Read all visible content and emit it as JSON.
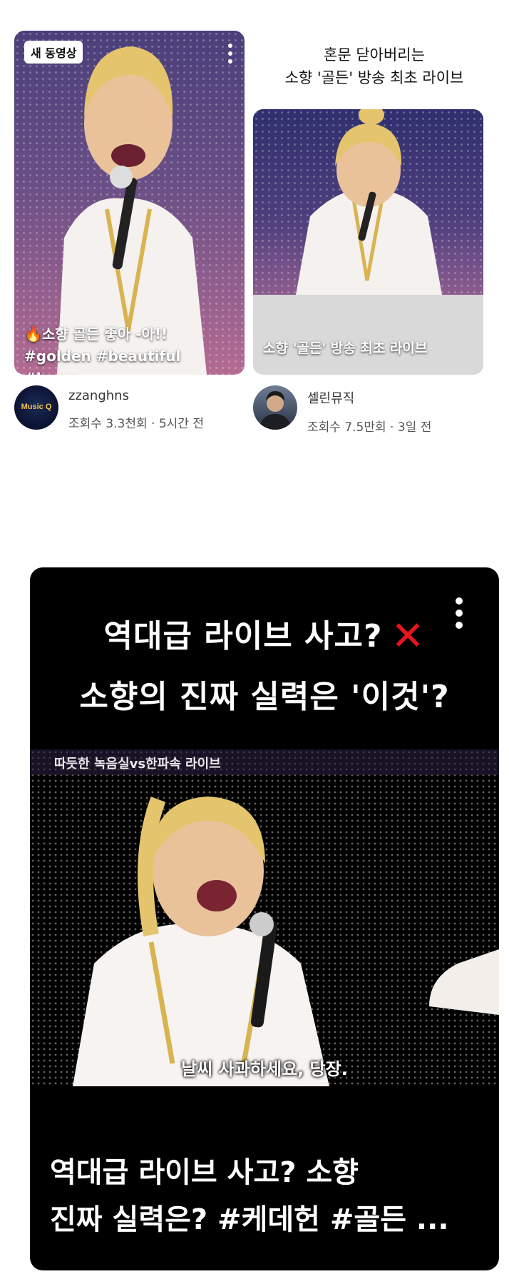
{
  "shorts": [
    {
      "badge": "새 동영상",
      "caption_line1": "🔥소향 골든 좋아 -아!!",
      "caption_line2": "#golden #beautiful #kpop...",
      "channel_name": "zzanghns",
      "meta": "조회수 3.3천회 · 5시간 전",
      "avatar_label": "Music Q"
    },
    {
      "overlay_title_line1": "혼문 닫아버리는",
      "overlay_title_line2": "소향 '골든' 방송 최초 라이브",
      "caption": "소향 '골든' 방송 최초 라이브",
      "channel_name": "셀린뮤직",
      "meta": "조회수 7.5만회 · 3일 전"
    }
  ],
  "feature": {
    "headline_line1": "역대급 라이브 사고?",
    "headline_line2": "소향의 진짜 실력은 '이것'?",
    "frame_top_text": "따듯한 녹음실vs한파속 라이브",
    "subtitle": "날씨 사과하세요, 당장.",
    "caption_line1": "역대급 라이브 사고? 소향",
    "caption_line2": "진짜 실력은? #케데헌 #골든 ..."
  },
  "colors": {
    "accent_red": "#e8141e",
    "card_bg": "#000000",
    "page_bg": "#ffffff"
  }
}
